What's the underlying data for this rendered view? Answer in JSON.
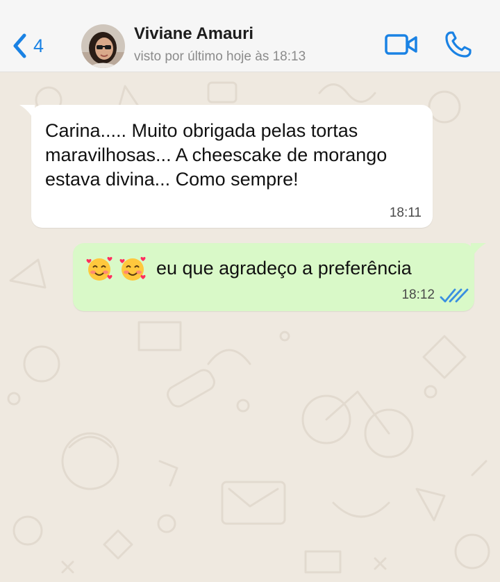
{
  "header": {
    "back_count": "4",
    "contact_name": "Viviane Amauri",
    "last_seen": "visto por último hoje às 18:13",
    "icons": {
      "back": "chevron-left-icon",
      "video": "video-camera-icon",
      "call": "phone-icon"
    },
    "accent_color": "#1a82e4"
  },
  "messages": [
    {
      "direction": "incoming",
      "text": "Carina..... Muito obrigada pelas tortas maravilhosas... A cheescake de morango estava divina... Como sempre!",
      "time": "18:11"
    },
    {
      "direction": "outgoing",
      "emojis": [
        "🥰",
        "🥰"
      ],
      "text": "eu que agradeço a preferência",
      "time": "18:12",
      "status": "read",
      "status_icon": "double-check-icon"
    }
  ],
  "colors": {
    "incoming_bubble": "#ffffff",
    "outgoing_bubble": "#d9f9c8",
    "chat_background": "#efe9e0",
    "read_ticks": "#3a8fe0"
  }
}
